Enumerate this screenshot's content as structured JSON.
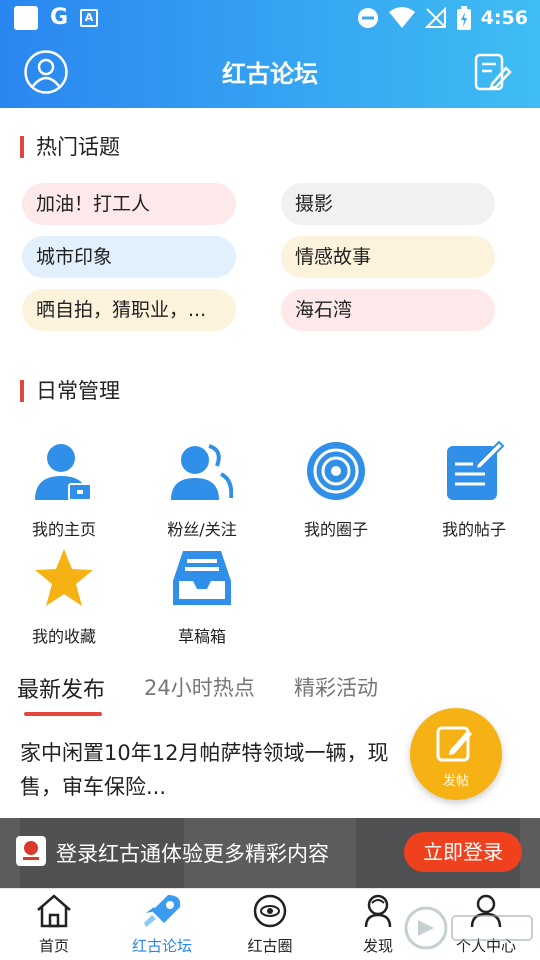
{
  "status_bar": {
    "time": "4:56",
    "g_letter": "G",
    "a_letter": "A"
  },
  "header": {
    "title": "红古论坛"
  },
  "hot_topics": {
    "title": "热门话题",
    "chips": [
      {
        "label": "加油！打工人",
        "bg": "#fde9ea"
      },
      {
        "label": "摄影",
        "bg": "#f1f1f1"
      },
      {
        "label": "城市印象",
        "bg": "#e2f0fd"
      },
      {
        "label": "情感故事",
        "bg": "#fdf3dc"
      },
      {
        "label": "晒自拍，猜职业，...",
        "bg": "#fdf3dc"
      },
      {
        "label": "海石湾",
        "bg": "#fde9ea"
      }
    ]
  },
  "daily": {
    "title": "日常管理",
    "items": [
      {
        "label": "我的主页",
        "icon": "user-home-icon"
      },
      {
        "label": "粉丝/关注",
        "icon": "fans-icon"
      },
      {
        "label": "我的圈子",
        "icon": "circle-icon"
      },
      {
        "label": "我的帖子",
        "icon": "post-icon"
      },
      {
        "label": "我的收藏",
        "icon": "star-icon"
      },
      {
        "label": "草稿箱",
        "icon": "drafts-icon"
      }
    ]
  },
  "tabs": [
    {
      "label": "最新发布"
    },
    {
      "label": "24小时热点"
    },
    {
      "label": "精彩活动"
    }
  ],
  "post": {
    "title": "家中闲置10年12月帕萨特领域一辆，现售，审车保险..."
  },
  "fab": {
    "label": "发帖"
  },
  "banner": {
    "text": "登录红古通体验更多精彩内容",
    "button": "立即登录"
  },
  "bottom_nav": [
    {
      "label": "首页",
      "icon": "home-icon"
    },
    {
      "label": "红古论坛",
      "icon": "rocket-icon"
    },
    {
      "label": "红古圈",
      "icon": "planet-icon"
    },
    {
      "label": "发现",
      "icon": "discover-icon"
    },
    {
      "label": "个人中心",
      "icon": "person-icon"
    }
  ],
  "colors": {
    "header_start": "#2a86f0",
    "header_end": "#3fbdf3",
    "accent_red": "#e3463c",
    "icon_blue": "#2f8fe9",
    "fab_yellow": "#f6b215",
    "login_red": "#f0411e"
  }
}
